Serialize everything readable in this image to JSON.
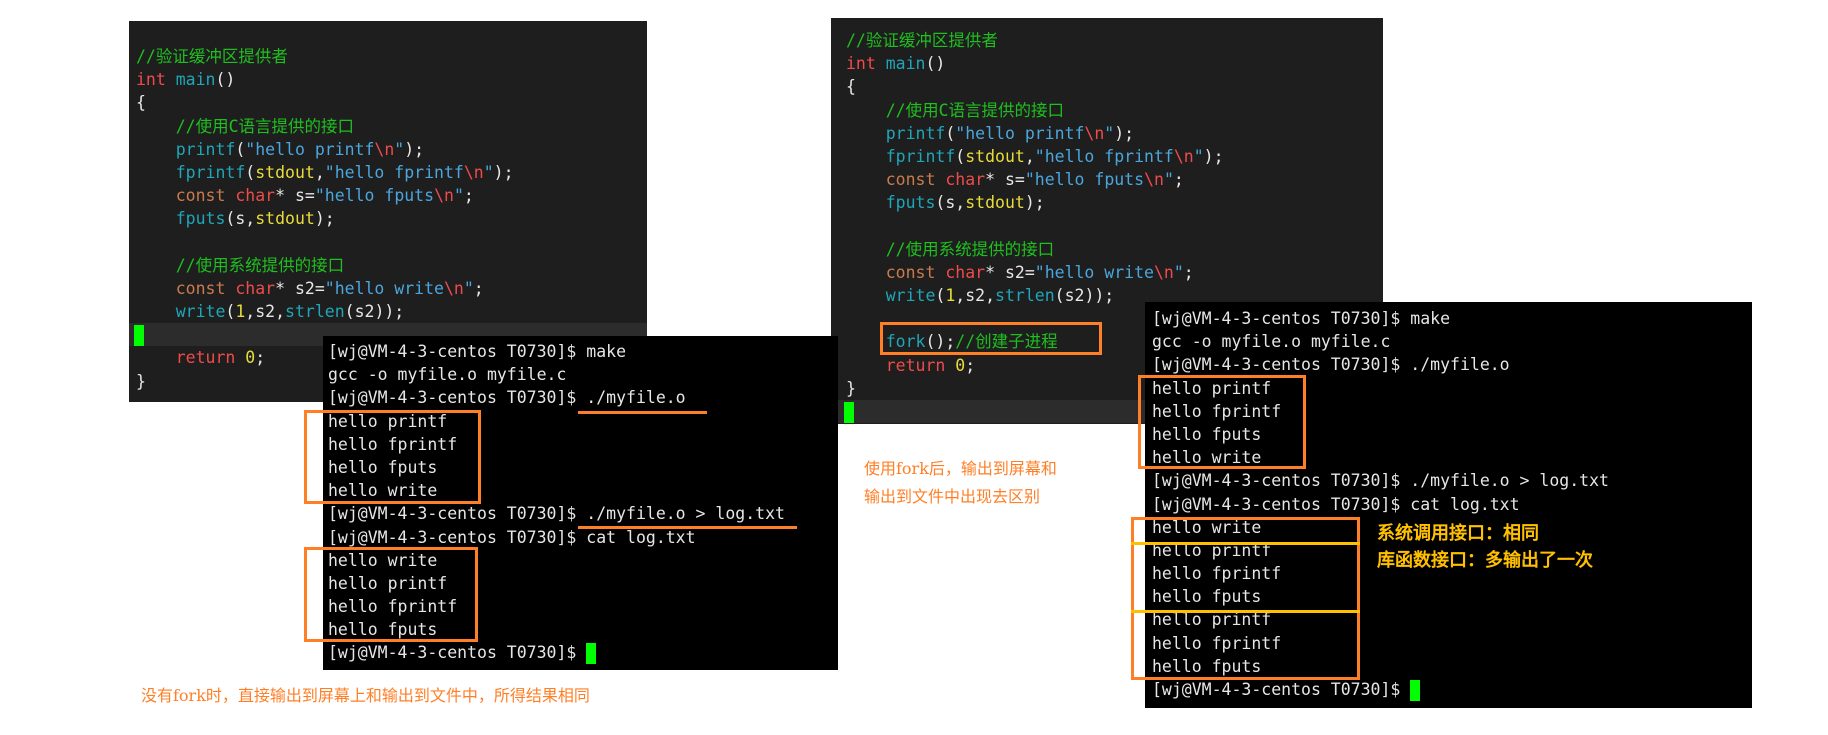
{
  "editor_left": {
    "lines": [
      [
        [
          "//验证缓冲区提供者",
          "cm"
        ]
      ],
      [
        [
          "int",
          "kw"
        ],
        [
          " ",
          "pl"
        ],
        [
          "main",
          "fn"
        ],
        [
          "()",
          "pl"
        ]
      ],
      [
        [
          "{",
          "pl"
        ]
      ],
      [
        [
          "    //使用C语言提供的接口",
          "cm"
        ]
      ],
      [
        [
          "    printf",
          "fn"
        ],
        [
          "(",
          "pl"
        ],
        [
          "\"hello printf",
          "st"
        ],
        [
          "\\n",
          "esc"
        ],
        [
          "\"",
          "st"
        ],
        [
          ");",
          "pl"
        ]
      ],
      [
        [
          "    fprintf",
          "fn"
        ],
        [
          "(",
          "pl"
        ],
        [
          "stdout",
          "yl"
        ],
        [
          ",",
          "pl"
        ],
        [
          "\"hello fprintf",
          "st"
        ],
        [
          "\\n",
          "esc"
        ],
        [
          "\"",
          "st"
        ],
        [
          ");",
          "pl"
        ]
      ],
      [
        [
          "    const",
          "ty"
        ],
        [
          " ",
          "pl"
        ],
        [
          "char",
          "kw"
        ],
        [
          "* s=",
          "pl"
        ],
        [
          "\"hello fputs",
          "st"
        ],
        [
          "\\n",
          "esc"
        ],
        [
          "\"",
          "st"
        ],
        [
          ";",
          "pl"
        ]
      ],
      [
        [
          "    fputs",
          "fn"
        ],
        [
          "(s,",
          "pl"
        ],
        [
          "stdout",
          "yl"
        ],
        [
          ");",
          "pl"
        ]
      ],
      [],
      [
        [
          "    //使用系统提供的接口",
          "cm"
        ]
      ],
      [
        [
          "    const",
          "ty"
        ],
        [
          " ",
          "pl"
        ],
        [
          "char",
          "kw"
        ],
        [
          "* s2=",
          "pl"
        ],
        [
          "\"hello write",
          "st"
        ],
        [
          "\\n",
          "esc"
        ],
        [
          "\"",
          "st"
        ],
        [
          ";",
          "pl"
        ]
      ],
      [
        [
          "    write",
          "fn"
        ],
        [
          "(",
          "pl"
        ],
        [
          "1",
          "yl"
        ],
        [
          ",s2,",
          "pl"
        ],
        [
          "strlen",
          "fn"
        ],
        [
          "(s2));",
          "pl"
        ]
      ],
      [],
      [
        [
          "    return",
          "kw"
        ],
        [
          " ",
          "pl"
        ],
        [
          "0",
          "yl"
        ],
        [
          ";",
          "pl"
        ]
      ],
      [
        [
          "}",
          "pl"
        ]
      ]
    ],
    "cursor_line": 12
  },
  "editor_right": {
    "lines": [
      [
        [
          "//验证缓冲区提供者",
          "cm"
        ]
      ],
      [
        [
          "int",
          "kw"
        ],
        [
          " ",
          "pl"
        ],
        [
          "main",
          "fn"
        ],
        [
          "()",
          "pl"
        ]
      ],
      [
        [
          "{",
          "pl"
        ]
      ],
      [
        [
          "    //使用C语言提供的接口",
          "cm"
        ]
      ],
      [
        [
          "    printf",
          "fn"
        ],
        [
          "(",
          "pl"
        ],
        [
          "\"hello printf",
          "st"
        ],
        [
          "\\n",
          "esc"
        ],
        [
          "\"",
          "st"
        ],
        [
          ");",
          "pl"
        ]
      ],
      [
        [
          "    fprintf",
          "fn"
        ],
        [
          "(",
          "pl"
        ],
        [
          "stdout",
          "yl"
        ],
        [
          ",",
          "pl"
        ],
        [
          "\"hello fprintf",
          "st"
        ],
        [
          "\\n",
          "esc"
        ],
        [
          "\"",
          "st"
        ],
        [
          ");",
          "pl"
        ]
      ],
      [
        [
          "    const",
          "ty"
        ],
        [
          " ",
          "pl"
        ],
        [
          "char",
          "kw"
        ],
        [
          "* s=",
          "pl"
        ],
        [
          "\"hello fputs",
          "st"
        ],
        [
          "\\n",
          "esc"
        ],
        [
          "\"",
          "st"
        ],
        [
          ";",
          "pl"
        ]
      ],
      [
        [
          "    fputs",
          "fn"
        ],
        [
          "(s,",
          "pl"
        ],
        [
          "stdout",
          "yl"
        ],
        [
          ");",
          "pl"
        ]
      ],
      [],
      [
        [
          "    //使用系统提供的接口",
          "cm"
        ]
      ],
      [
        [
          "    const",
          "ty"
        ],
        [
          " ",
          "pl"
        ],
        [
          "char",
          "kw"
        ],
        [
          "* s2=",
          "pl"
        ],
        [
          "\"hello write",
          "st"
        ],
        [
          "\\n",
          "esc"
        ],
        [
          "\"",
          "st"
        ],
        [
          ";",
          "pl"
        ]
      ],
      [
        [
          "    write",
          "fn"
        ],
        [
          "(",
          "pl"
        ],
        [
          "1",
          "yl"
        ],
        [
          ",s2,",
          "pl"
        ],
        [
          "strlen",
          "fn"
        ],
        [
          "(s2));",
          "pl"
        ]
      ],
      [],
      [
        [
          "    fork",
          "fn"
        ],
        [
          "();",
          "pl"
        ],
        [
          "//创建子进程",
          "cm"
        ]
      ],
      [
        [
          "    return",
          "kw"
        ],
        [
          " ",
          "pl"
        ],
        [
          "0",
          "yl"
        ],
        [
          ";",
          "pl"
        ]
      ],
      [
        [
          "}",
          "pl"
        ]
      ],
      []
    ],
    "cursor_line": 16
  },
  "terminal_left": {
    "lines": [
      "[wj@VM-4-3-centos T0730]$ make",
      "gcc -o myfile.o myfile.c",
      "[wj@VM-4-3-centos T0730]$ ./myfile.o",
      "hello printf",
      "hello fprintf",
      "hello fputs",
      "hello write",
      "[wj@VM-4-3-centos T0730]$ ./myfile.o > log.txt",
      "[wj@VM-4-3-centos T0730]$ cat log.txt",
      "hello write",
      "hello printf",
      "hello fprintf",
      "hello fputs",
      "[wj@VM-4-3-centos T0730]$ "
    ]
  },
  "terminal_right": {
    "lines": [
      "[wj@VM-4-3-centos T0730]$ make",
      "gcc -o myfile.o myfile.c",
      "[wj@VM-4-3-centos T0730]$ ./myfile.o",
      "hello printf",
      "hello fprintf",
      "hello fputs",
      "hello write",
      "[wj@VM-4-3-centos T0730]$ ./myfile.o > log.txt",
      "[wj@VM-4-3-centos T0730]$ cat log.txt",
      "hello write",
      "hello printf",
      "hello fprintf",
      "hello fputs",
      "hello printf",
      "hello fprintf",
      "hello fputs",
      "[wj@VM-4-3-centos T0730]$ "
    ],
    "note_line1": "系统调用接口：相同",
    "note_line2": "库函数接口：多输出了一次"
  },
  "captions": {
    "no_fork": "没有fork时，直接输出到屏幕上和输出到文件中，所得结果相同",
    "with_fork_line1": "使用fork后，输出到屏幕和",
    "with_fork_line2": "输出到文件中出现去区别"
  },
  "colors": {
    "annotation_orange": "#ff7f27",
    "annotation_yellow": "#ffc000",
    "cursor_green": "#00ff00"
  }
}
